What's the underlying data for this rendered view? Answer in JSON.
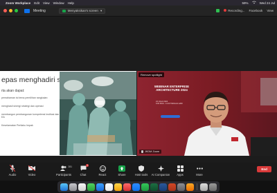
{
  "menubar": {
    "app_name": "Zoom Workplace",
    "items": [
      "Edit",
      "View",
      "Window",
      "Help"
    ],
    "battery": "59%",
    "datetime": "Wed 24 Jul"
  },
  "window": {
    "title": "Meeting",
    "share_label": "Menyaksikan's screen",
    "recording_label": "Recording...",
    "facebook_label": "Facebook",
    "view_label": "View"
  },
  "slide": {
    "title": "epas menghadiri sesi ini",
    "subtitle": "rta akan dapat:",
    "bullets": [
      "pemahaman isi tema pemilihan rangkaian",
      "menghasil sinergi strategi dan operasi",
      "membangun pembangunan kompetensi institusi dan EA",
      "Keselamatan Perilaku Impak"
    ]
  },
  "speaker": {
    "spotlight_label": "Remove spotlight",
    "poster_title": "WEBINAR ENTERPRISE ARCHITECTURE 2024",
    "poster_date": "24 JULAI 2024",
    "poster_time": "9.00 PAGI - 11.00 TENGAH HARI",
    "name": "JKDM Zoom"
  },
  "toolbar": {
    "items": [
      {
        "label": "Audio",
        "icon": "microphone-icon"
      },
      {
        "label": "Video",
        "icon": "video-camera-icon"
      },
      {
        "label": "Participants",
        "icon": "participants-icon",
        "count": "281"
      },
      {
        "label": "Chat",
        "icon": "chat-icon",
        "badge": "1"
      },
      {
        "label": "React",
        "icon": "react-icon"
      },
      {
        "label": "Share",
        "icon": "share-screen-icon"
      },
      {
        "label": "Host tools",
        "icon": "shield-icon"
      },
      {
        "label": "AI Companion",
        "icon": "ai-companion-icon"
      },
      {
        "label": "Apps",
        "icon": "apps-icon"
      },
      {
        "label": "More",
        "icon": "more-icon"
      }
    ],
    "leave_label": "End"
  },
  "colors": {
    "accent_blue": "#0e72ed",
    "share_green": "#18a34a",
    "end_red": "#d93a3a",
    "speaker_bg": "#7b1c23"
  }
}
